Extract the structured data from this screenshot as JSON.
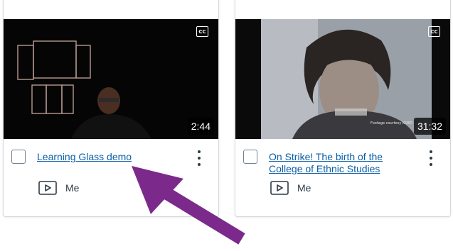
{
  "cards": [
    {
      "title": "Learning Glass demo",
      "duration": "2:44",
      "cc": "CC",
      "owner": "Me"
    },
    {
      "title": "On Strike! The birth of the College of Ethnic Studies",
      "duration": "31:32",
      "cc": "CC",
      "owner": "Me",
      "thumbnail_caption": "Footage courtesy KQED"
    }
  ],
  "colors": {
    "link": "#0b5fa8",
    "arrow": "#7b2a8c",
    "border": "#d6d9dc",
    "text": "#2d3b45"
  },
  "icons": [
    "closed-captions-icon",
    "more-options-icon",
    "play-icon",
    "annotation-arrow"
  ]
}
